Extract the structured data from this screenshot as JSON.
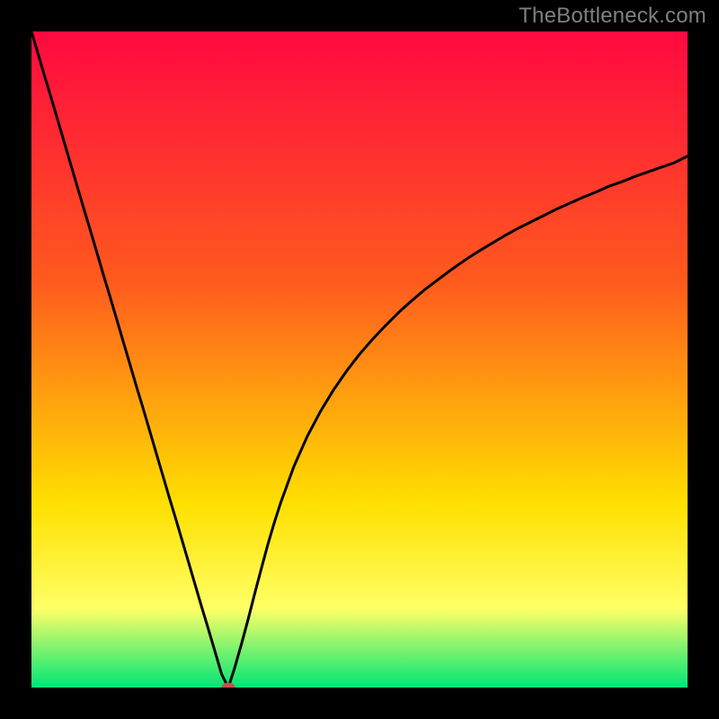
{
  "watermark": "TheBottleneck.com",
  "colors": {
    "frame_background": "#000000",
    "grad_top": "#ff0840",
    "grad_upper_mid": "#ff5a1e",
    "grad_lower_mid": "#ffe000",
    "grad_bottom": "#00e676",
    "curve": "#000000",
    "marker_fill": "#cc4e4e",
    "marker_stroke": "#cc4e4e",
    "watermark_text": "#808080"
  },
  "chart_data": {
    "type": "line",
    "title": "",
    "xlabel": "",
    "ylabel": "",
    "xlim": [
      0,
      100
    ],
    "ylim": [
      0,
      100
    ],
    "x": [
      0,
      1,
      2,
      3,
      4,
      5,
      6,
      7,
      8,
      9,
      10,
      11,
      12,
      13,
      14,
      15,
      16,
      17,
      18,
      19,
      20,
      21,
      22,
      23,
      24,
      25,
      26,
      27,
      28,
      29,
      30,
      31,
      32,
      33,
      34,
      35,
      36,
      37,
      38,
      40,
      42,
      44,
      46,
      48,
      50,
      52,
      54,
      56,
      58,
      60,
      62,
      64,
      66,
      68,
      70,
      72,
      74,
      76,
      78,
      80,
      82,
      84,
      86,
      88,
      90,
      92,
      94,
      96,
      98,
      100
    ],
    "y": [
      100,
      96.6,
      93.2,
      89.9,
      86.5,
      83.1,
      79.7,
      76.3,
      72.9,
      69.6,
      66.2,
      62.8,
      59.5,
      56.1,
      52.7,
      49.3,
      45.9,
      42.6,
      39.2,
      35.8,
      32.4,
      29.0,
      25.7,
      22.3,
      18.9,
      15.5,
      12.1,
      8.8,
      5.4,
      2.0,
      0.0,
      3.1,
      6.6,
      10.3,
      14.2,
      18.0,
      21.7,
      25.1,
      28.2,
      33.7,
      38.2,
      42.0,
      45.3,
      48.2,
      50.8,
      53.1,
      55.2,
      57.2,
      59.0,
      60.7,
      62.2,
      63.7,
      65.1,
      66.4,
      67.6,
      68.8,
      69.9,
      70.9,
      71.9,
      72.9,
      73.8,
      74.7,
      75.5,
      76.4,
      77.1,
      77.9,
      78.6,
      79.3,
      80.0,
      81.0
    ],
    "marker": {
      "x": 30,
      "y": 0
    }
  }
}
